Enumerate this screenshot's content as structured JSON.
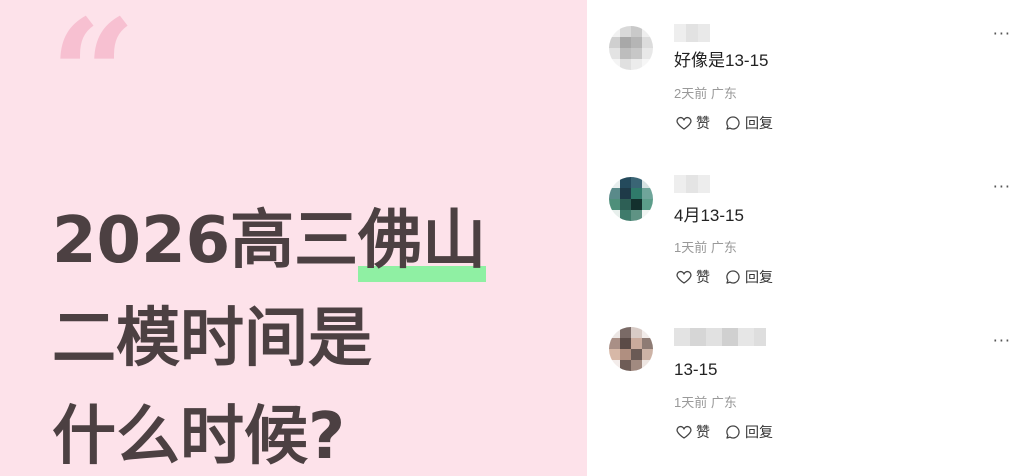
{
  "promo": {
    "quote_mark": "“",
    "headline_line1_a": "2026高三",
    "headline_line1_highlight": "佛山",
    "headline_line2": "二模时间是",
    "headline_line3": "什么时候?"
  },
  "comments": [
    {
      "text": "好像是13-15",
      "meta": "2天前 广东",
      "like_label": "赞",
      "reply_label": "回复",
      "more_label": "···"
    },
    {
      "text": "4月13-15",
      "meta": "1天前 广东",
      "like_label": "赞",
      "reply_label": "回复",
      "more_label": "···"
    },
    {
      "text": "13-15",
      "meta": "1天前 广东",
      "like_label": "赞",
      "reply_label": "回复",
      "more_label": "···"
    }
  ],
  "colors": {
    "panel_bg": "#fde2ea",
    "headline": "#4c4042",
    "highlight": "#8ff0a3",
    "quote": "#f7c0d1"
  },
  "icons": {
    "like": "heart-outline-icon",
    "reply": "speech-bubble-icon",
    "more": "ellipsis-icon"
  }
}
